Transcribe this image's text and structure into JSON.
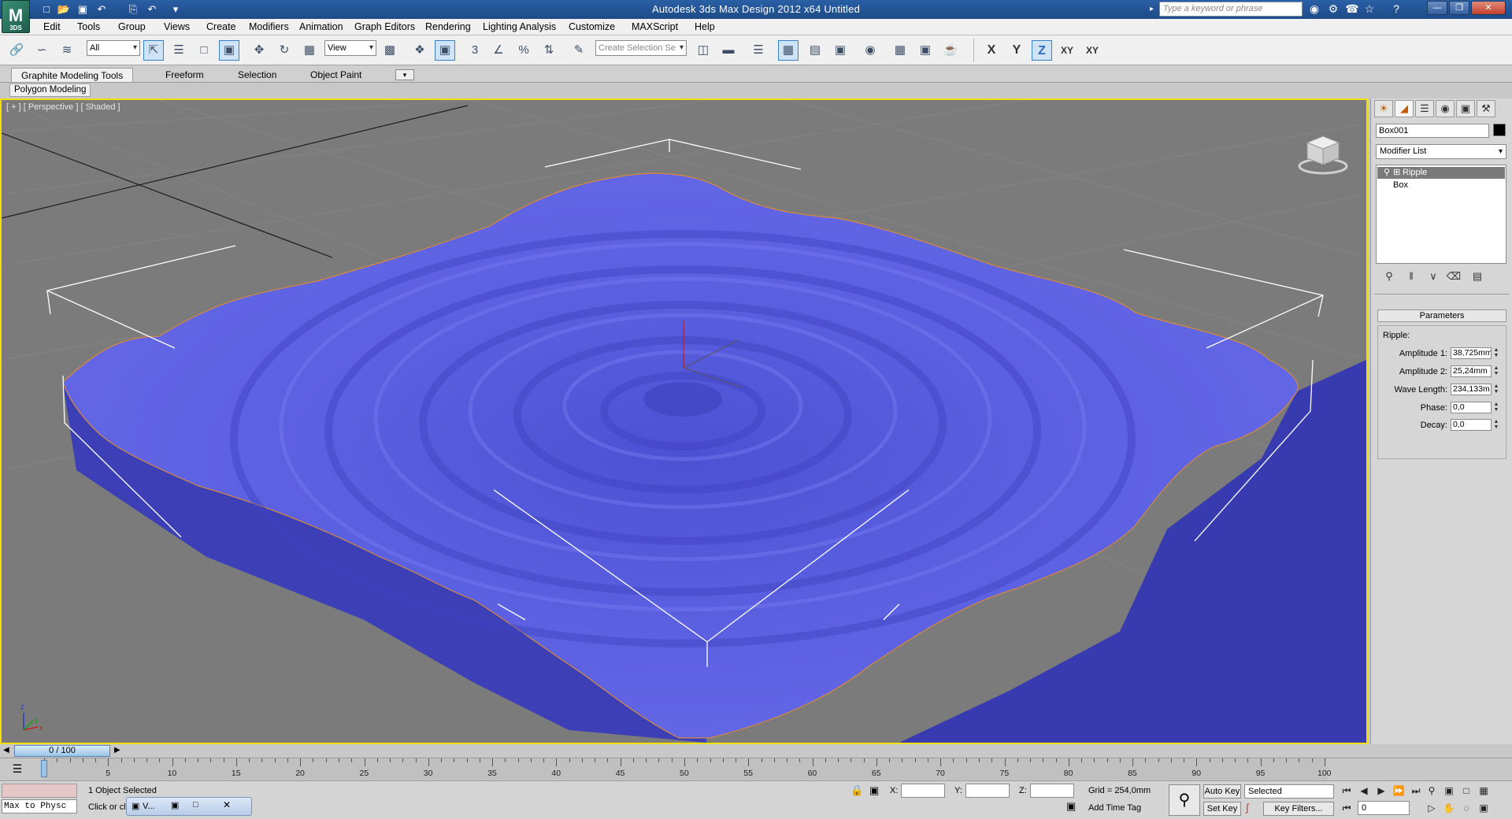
{
  "window": {
    "title": "Autodesk 3ds Max Design 2012 x64      Untitled",
    "logo_text": "3DS",
    "search_placeholder": "Type a keyword or phrase"
  },
  "menus": [
    "Edit",
    "Tools",
    "Group",
    "Views",
    "Create",
    "Modifiers",
    "Animation",
    "Graph Editors",
    "Rendering",
    "Lighting Analysis",
    "Customize",
    "MAXScript",
    "Help"
  ],
  "toolbar": {
    "selection_filter": "All",
    "reference_coord": "View",
    "named_selection_placeholder": "Create Selection Se",
    "axis_x": "X",
    "axis_y": "Y",
    "axis_z": "Z",
    "axis_xy": "XY",
    "axis_xy2": "XY"
  },
  "ribbon": {
    "tabs": [
      "Graphite Modeling Tools",
      "Freeform",
      "Selection",
      "Object Paint"
    ],
    "active_panel": "Polygon Modeling"
  },
  "viewport": {
    "label": "[ + ] [ Perspective ] [ Shaded ]",
    "border_color": "#f3e000",
    "surface_color": "#5a5fe0",
    "side_color": "#3a3bb0"
  },
  "command_panel": {
    "object_name": "Box001",
    "modifier_list": "Modifier List",
    "stack": [
      "Ripple",
      "Box"
    ],
    "rollout_title": "Parameters",
    "group_label": "Ripple:",
    "params": [
      {
        "label": "Amplitude 1:",
        "value": "38,725mm"
      },
      {
        "label": "Amplitude 2:",
        "value": "25,24mm"
      },
      {
        "label": "Wave Length:",
        "value": "234,133m"
      },
      {
        "label": "Phase:",
        "value": "0,0"
      },
      {
        "label": "Decay:",
        "value": "0,0"
      }
    ]
  },
  "timeline": {
    "slider": "0 / 100",
    "ticks": [
      "0",
      "5",
      "10",
      "15",
      "20",
      "25",
      "30",
      "35",
      "40",
      "45",
      "50",
      "55",
      "60",
      "65",
      "70",
      "75",
      "80",
      "85",
      "90",
      "95",
      "100"
    ]
  },
  "status": {
    "script_listener": "Max to Physc",
    "selection": "1 Object Selected",
    "prompt": "Click or cli",
    "taskbar_item": "V...",
    "x_label": "X:",
    "y_label": "Y:",
    "z_label": "Z:",
    "grid": "Grid = 254,0mm",
    "add_time_tag": "Add Time Tag",
    "auto_key": "Auto Key",
    "set_key": "Set Key",
    "key_mode": "Selected",
    "key_filters": "Key Filters...",
    "frame": "0"
  }
}
